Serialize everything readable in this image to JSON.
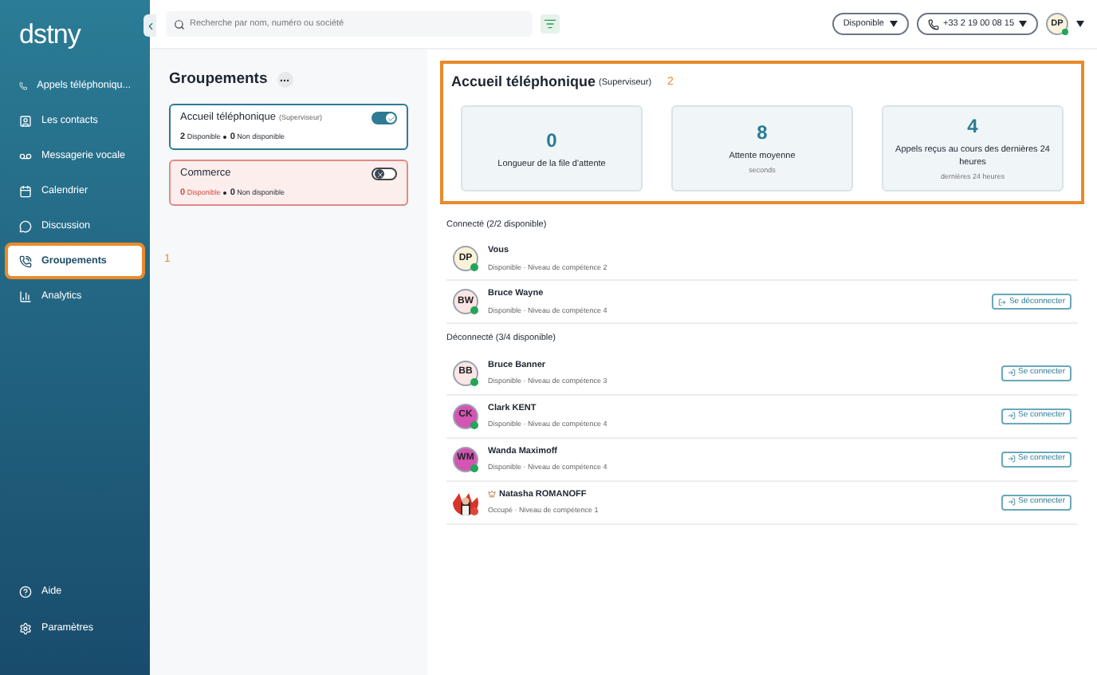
{
  "sidebar": {
    "logo": "dstny",
    "items": [
      {
        "label": "Appels téléphoniqu...",
        "selected": false,
        "highlighted": false
      },
      {
        "label": "Les contacts",
        "selected": false,
        "highlighted": false
      },
      {
        "label": "Messagerie vocale",
        "selected": false,
        "highlighted": false
      },
      {
        "label": "Calendrier",
        "selected": false,
        "highlighted": false
      },
      {
        "label": "Discussion",
        "selected": false,
        "highlighted": false
      },
      {
        "label": "Groupements",
        "selected": true,
        "highlighted": true
      },
      {
        "label": "Analytics",
        "selected": false,
        "highlighted": false
      }
    ],
    "bottom_items": [
      {
        "label": "Aide"
      },
      {
        "label": "Paramètres"
      }
    ],
    "annotation": "1"
  },
  "topbar": {
    "search": {
      "placeholder": "Recherche par nom, numéro ou société"
    },
    "status": "Disponible",
    "phone": "+33 2 19 00 08 15",
    "avatar": "DP"
  },
  "groups_panel": {
    "title": "Groupements",
    "groups": [
      {
        "name": "Accueil téléphonique",
        "role": "(Superviseur)",
        "available": "2",
        "available_label": "Disponible",
        "unavailable": "0",
        "unavailable_label": "Non disponible",
        "on": true
      },
      {
        "name": "Commerce",
        "available": "0",
        "available_label": "Disponible",
        "unavailable": "0",
        "unavailable_label": "Non disponible",
        "on": false
      }
    ]
  },
  "detail": {
    "title": "Accueil téléphonique",
    "role": "(Superviseur)",
    "annotation": "2",
    "highlighted": true,
    "stats": [
      {
        "value": "0",
        "label": "Longueur de la file d'attente"
      },
      {
        "value": "8",
        "label": "Attente moyenne",
        "sub": "seconds"
      },
      {
        "value": "4",
        "label": "Appels reçus au cours des dernières 24 heures",
        "sub": "dernières 24 heures"
      }
    ],
    "sections": [
      {
        "title": "Connecté (2/2 disponible)",
        "members": [
          {
            "kind": "initials",
            "initials": "DP",
            "name": "Vous",
            "status": "Disponible · Niveau de compétence 2",
            "color": "#22a559"
          },
          {
            "kind": "initials",
            "initials": "BW",
            "name": "Bruce Wayne",
            "status": "Disponible · Niveau de compétence 4",
            "color": "#22a559",
            "action": "Se déconnecter"
          }
        ]
      },
      {
        "title": "Déconnecté (3/4 disponible)",
        "members": [
          {
            "kind": "initials",
            "initials": "BB",
            "name": "Bruce Banner",
            "status": "Disponible · Niveau de compétence 3",
            "color": "#22a559",
            "action": "Se connecter"
          },
          {
            "kind": "initials",
            "initials": "CK",
            "name": "Clark KENT",
            "status": "Disponible · Niveau de compétence 4",
            "color": "#22a559",
            "action": "Se connecter"
          },
          {
            "kind": "initials",
            "initials": "WM",
            "name": "Wanda Maximoff",
            "status": "Disponible · Niveau de compétence 4",
            "color": "#22a559",
            "action": "Se connecter"
          },
          {
            "kind": "picture",
            "name": "Natasha ROMANOFF",
            "crown": true,
            "status": "Occupé · Niveau de compétence 1",
            "color": "#e0453a",
            "action": "Se connecter"
          }
        ]
      }
    ]
  }
}
